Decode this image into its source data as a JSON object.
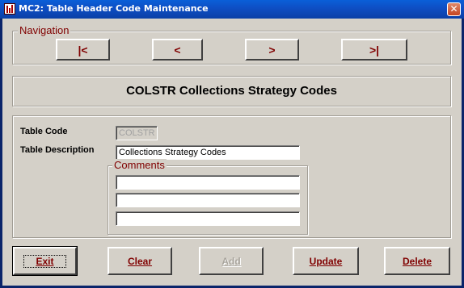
{
  "window": {
    "title": "MC2: Table Header Code Maintenance",
    "close_glyph": "✕"
  },
  "navigation": {
    "legend": "Navigation",
    "first_label": "|<",
    "prev_label": "<",
    "next_label": ">",
    "last_label": ">|"
  },
  "header": {
    "title": "COLSTR Collections Strategy Codes"
  },
  "form": {
    "table_code_label": "Table Code",
    "table_code_value": "COLSTR",
    "table_description_label": "Table Description",
    "table_description_value": "Collections Strategy Codes",
    "comments_legend": "Comments",
    "comments": [
      "",
      "",
      ""
    ]
  },
  "actions": {
    "exit_label": "Exit",
    "clear_label": "Clear",
    "add_label": "Add",
    "update_label": "Update",
    "delete_label": "Delete"
  }
}
